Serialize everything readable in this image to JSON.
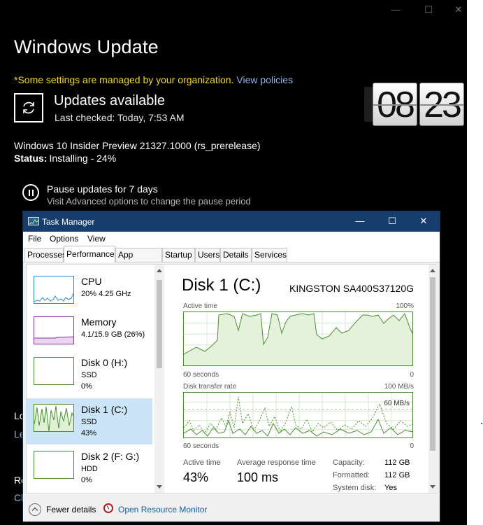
{
  "windows_update": {
    "title": "Windows Update",
    "managed_notice": "*Some settings are managed by your organization.",
    "view_policies": "View policies",
    "status_heading": "Updates available",
    "last_checked": "Last checked: Today, 7:53 AM",
    "update_name": "Windows 10 Insider Preview 21327.1000 (rs_prerelease)",
    "status_label": "Status:",
    "status_value": "Installing - 24%",
    "pause_title": "Pause updates for 7 days",
    "pause_subtitle": "Visit Advanced options to change the pause period",
    "frag1": "Lo",
    "frag2": "Le",
    "frag3": "Re",
    "frag4": "Ch",
    "controls": {
      "minimize": "—",
      "maximize": "☐",
      "close": "✕"
    },
    "colors": {
      "background": "#000000",
      "notice": "#f5d90a",
      "link": "#8ab4e6"
    }
  },
  "clock": {
    "hours": "08",
    "minutes": "23"
  },
  "task_manager": {
    "title": "Task Manager",
    "controls": {
      "minimize": "—",
      "maximize": "☐",
      "close": "✕"
    },
    "menu": [
      "File",
      "Options",
      "View"
    ],
    "tabs": [
      "Processes",
      "Performance",
      "App history",
      "Startup",
      "Users",
      "Details",
      "Services"
    ],
    "active_tab": "Performance",
    "resources": [
      {
        "name": "CPU",
        "line1": "20%  4.25 GHz",
        "line2": "",
        "color": "#2a8bd4"
      },
      {
        "name": "Memory",
        "line1": "4.1/15.9 GB (26%)",
        "line2": "",
        "color": "#8b2fa8"
      },
      {
        "name": "Disk 0 (H:)",
        "line1": "SSD",
        "line2": "0%",
        "color": "#4a8f2f"
      },
      {
        "name": "Disk 1 (C:)",
        "line1": "SSD",
        "line2": "43%",
        "color": "#4a8f2f"
      },
      {
        "name": "Disk 2 (F: G:)",
        "line1": "HDD",
        "line2": "0%",
        "color": "#4a8f2f"
      }
    ],
    "selected_resource": "Disk 1 (C:)",
    "detail": {
      "title": "Disk 1 (C:)",
      "model": "KINGSTON SA400S37120G",
      "graph1_label": "Active time",
      "graph1_max": "100%",
      "graph1_time": "60 seconds",
      "graph1_min": "0",
      "graph2_label": "Disk transfer rate",
      "graph2_max": "100 MB/s",
      "graph2_mid": "60 MB/s",
      "graph2_time": "60 seconds",
      "graph2_min": "0",
      "active_time_label": "Active time",
      "active_time_value": "43%",
      "response_label": "Average response time",
      "response_value": "100 ms",
      "capacity_label": "Capacity:",
      "capacity_value": "112 GB",
      "formatted_label": "Formatted:",
      "formatted_value": "112 GB",
      "system_disk_label": "System disk:",
      "system_disk_value": "Yes"
    },
    "footer": {
      "fewer_details": "Fewer details",
      "resource_monitor": "Open Resource Monitor"
    },
    "colors": {
      "titlebar": "#163d6b",
      "selected": "#cce4f7",
      "disk_graph": "#4a8f2f"
    }
  }
}
